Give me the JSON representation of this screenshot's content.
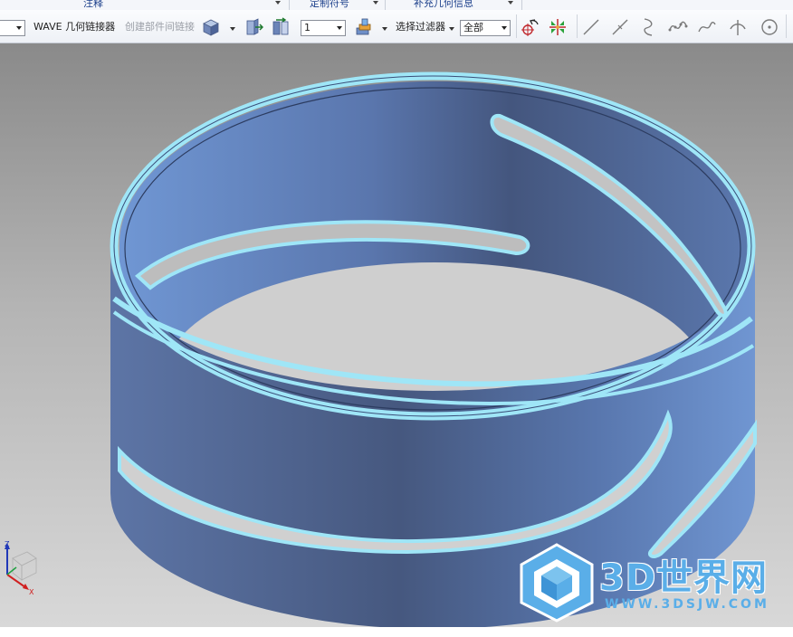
{
  "ribbon_groups": [
    "注释",
    "定制符号",
    "补充几何信息"
  ],
  "toolbar": {
    "left_combo_value": "",
    "wave_label": "WAVE 几何链接器",
    "create_link_label": "创建部件间链接",
    "layer_combo_value": "1",
    "filter_label": "选择过滤器",
    "filter_combo_value": "全部"
  },
  "icons": [
    "solid-cube-icon",
    "move-face-icon",
    "mirror-face-icon",
    "layer-stack-icon",
    "refresh-select-icon",
    "snap-point-icon",
    "line-icon",
    "line-point-icon",
    "arc-icon",
    "spline-icon",
    "curve-icon",
    "intersection-icon",
    "circle-point-icon"
  ],
  "triad": {
    "x_label": "X",
    "z_label": "Z"
  },
  "watermark": {
    "title": "3D世界网",
    "url": "WWW.3DSJW.COM"
  },
  "colors": {
    "band_dark": "#46587f",
    "band_light": "#6e93cf",
    "edge": "#9fe6f7",
    "accent": "#5aaee8"
  }
}
